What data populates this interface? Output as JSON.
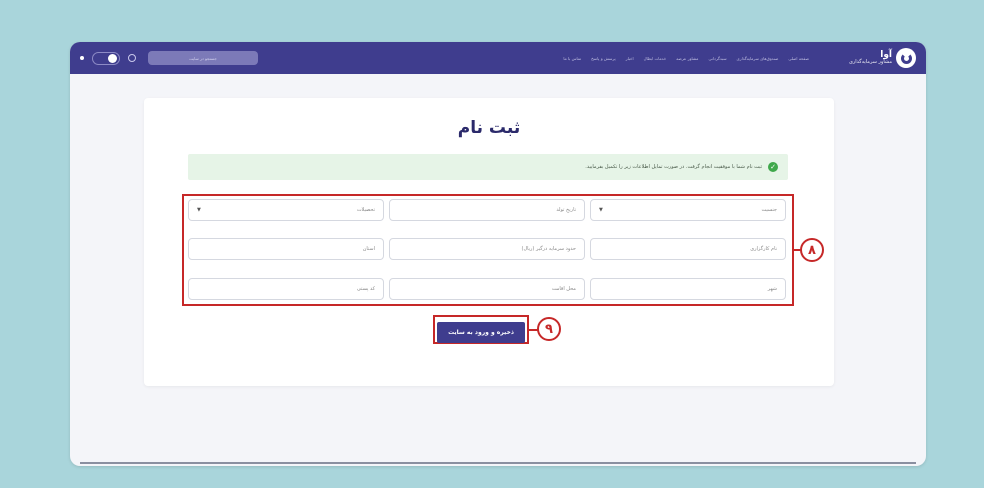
{
  "topbar": {
    "logo_name": "آوا",
    "logo_sub": "مشاور سرمایه‌گذاری",
    "nav": [
      "صفحه اصلی",
      "صندوق‌های سرمایه‌گذاری",
      "سبد‌گردانی",
      "مشاور عرضه",
      "خدمات ابطال",
      "اخبار",
      "پرسش و پاسخ",
      "تماس با ما"
    ],
    "search_placeholder": "جستجو در سایت"
  },
  "page": {
    "title": "ثبت نام",
    "alert": "ثبت نام شما با موفقیت انجام گرفت. در صورت تمایل اطلاعات زیر را تکمیل بفرمایید."
  },
  "form": {
    "gender": "جنسیت",
    "birth_date": "تاریخ تولد",
    "education": "تحصیلات",
    "broker_name": "نام کارگزاری",
    "investment_limit": "حدود سرمایه درگیر (ریال)",
    "province": "استان",
    "city": "شهر",
    "residence": "محل اقامت",
    "postal_code": "کد پستی"
  },
  "annotations": {
    "form_badge": "۸",
    "button_badge": "۹"
  },
  "actions": {
    "save_label": "ذخیره و ورود به سایت"
  }
}
